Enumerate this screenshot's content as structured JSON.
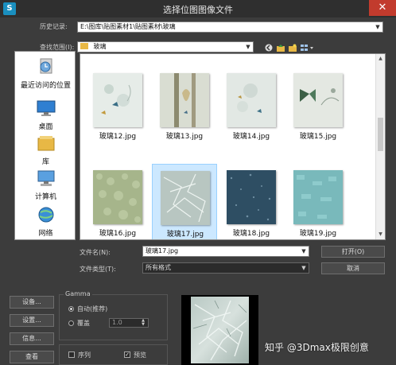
{
  "window": {
    "title": "选择位图图像文件",
    "close_glyph": "✕",
    "app_icon_letter": "S"
  },
  "history": {
    "label": "历史记录:",
    "value": "E:\\图库\\贴图素材1\\贴图素材\\玻璃"
  },
  "lookin": {
    "label": "查找范围(I):",
    "value": "玻璃"
  },
  "places": [
    {
      "label": "最近访问的位置",
      "icon": "recent-places-icon"
    },
    {
      "label": "桌面",
      "icon": "desktop-icon"
    },
    {
      "label": "库",
      "icon": "library-icon"
    },
    {
      "label": "计算机",
      "icon": "computer-icon"
    },
    {
      "label": "网络",
      "icon": "network-icon"
    }
  ],
  "files": [
    {
      "name": "玻璃12.jpg",
      "style": "frosted-butterfly-flowers"
    },
    {
      "name": "玻璃13.jpg",
      "style": "striped-vase"
    },
    {
      "name": "玻璃14.jpg",
      "style": "frosted-flowers"
    },
    {
      "name": "玻璃15.jpg",
      "style": "butterfly-vine"
    },
    {
      "name": "玻璃16.jpg",
      "style": "green-pebble"
    },
    {
      "name": "玻璃17.jpg",
      "style": "crackle-glass",
      "selected": true
    },
    {
      "name": "玻璃18.jpg",
      "style": "dark-blue-speckle"
    },
    {
      "name": "玻璃19.jpg",
      "style": "aqua-texture"
    }
  ],
  "filename": {
    "label": "文件名(N):",
    "value": "玻璃17.jpg"
  },
  "filetype": {
    "label": "文件类型(T):",
    "value": "所有格式"
  },
  "buttons": {
    "open": "打开(O)",
    "cancel": "取消",
    "setup": "设备...",
    "settings": "设置...",
    "info": "信息...",
    "view": "查看"
  },
  "gamma": {
    "title": "Gamma",
    "auto_label": "自动(推荐)",
    "override_label": "覆盖",
    "override_value": "1.0",
    "selected": "auto"
  },
  "options": {
    "sequence_label": "序列",
    "sequence_checked": false,
    "preview_label": "预览",
    "preview_checked": true
  },
  "watermark": "知乎 @3Dmax极限创意",
  "colors": {
    "selection": "#cce8ff",
    "accent": "#1a8fbf",
    "close": "#c23b2d"
  }
}
